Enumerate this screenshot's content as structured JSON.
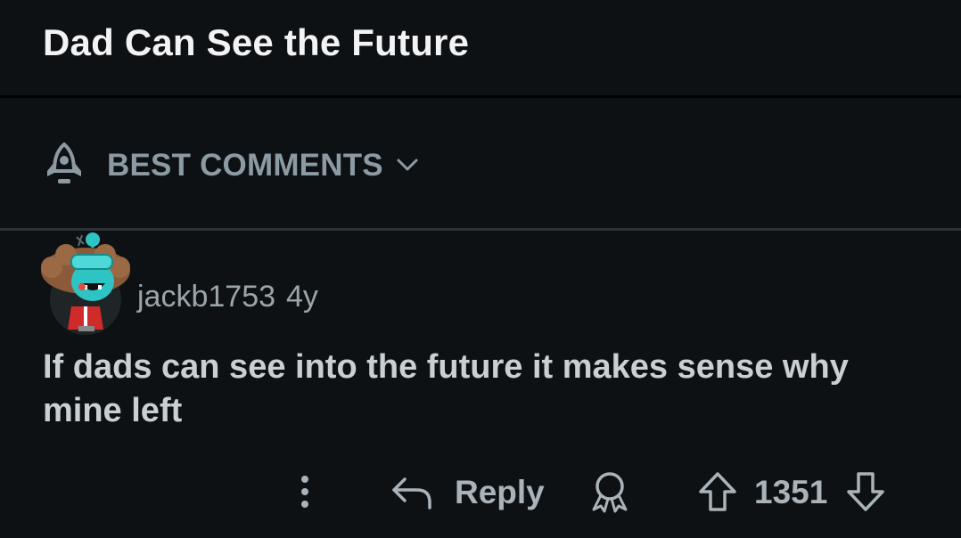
{
  "post": {
    "title": "Dad Can See the Future"
  },
  "sort": {
    "label": "BEST COMMENTS",
    "icon": "rocket-icon",
    "dropdown_icon": "chevron-down-icon"
  },
  "comment": {
    "author": "jackb1753",
    "age": "4y",
    "body": "If dads can see into the future it makes sense why mine left",
    "avatar_icon": "snoo-avatar-icon"
  },
  "actions": {
    "more_icon": "more-vertical-icon",
    "reply_icon": "reply-arrow-icon",
    "reply_label": "Reply",
    "award_icon": "award-icon",
    "upvote_icon": "upvote-arrow-icon",
    "vote_count": "1351",
    "downvote_icon": "downvote-arrow-icon"
  },
  "colors": {
    "background": "#0e1113",
    "title": "#f2f3f5",
    "muted": "#8c9aa3",
    "accent_teal": "#2ec4c4"
  }
}
